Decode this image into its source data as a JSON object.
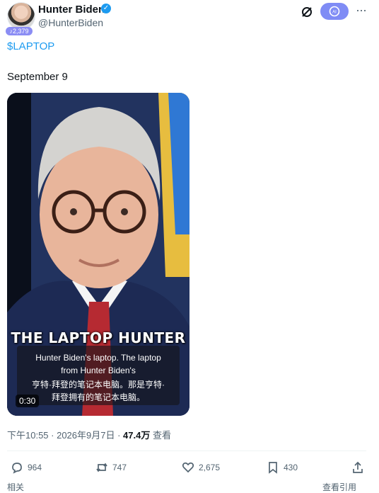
{
  "header": {
    "author_name": "Hunter Biden",
    "handle": "@HunterBiden",
    "avatar_badge": "♪2,379",
    "verified_mark": "✓",
    "grok_label": "AI",
    "more_glyph": "···"
  },
  "post": {
    "cashtag": "$LAPTOP",
    "text": "September 9"
  },
  "video": {
    "overlay_title": "THE LAPTOP HUNTER",
    "subtitle_lines": [
      "Hunter Biden's laptop. The laptop",
      "from Hunter Biden's",
      "亨特·拜登的笔记本电脑。那是亨特·",
      "拜登拥有的笔记本电脑。"
    ],
    "duration": "0:30"
  },
  "meta": {
    "time_date": "下午10:55 · 2026年9月7日 · ",
    "views": "47.4万",
    "views_suffix": " 查看"
  },
  "actions": {
    "replies": "964",
    "reposts": "747",
    "likes": "2,675",
    "bookmarks": "430"
  },
  "footer": {
    "left_text": "相关",
    "right_text": "查看引用"
  },
  "colors": {
    "accent": "#1d9bf0",
    "grok_button": "#7f8cf5",
    "muted_text": "#536471"
  }
}
